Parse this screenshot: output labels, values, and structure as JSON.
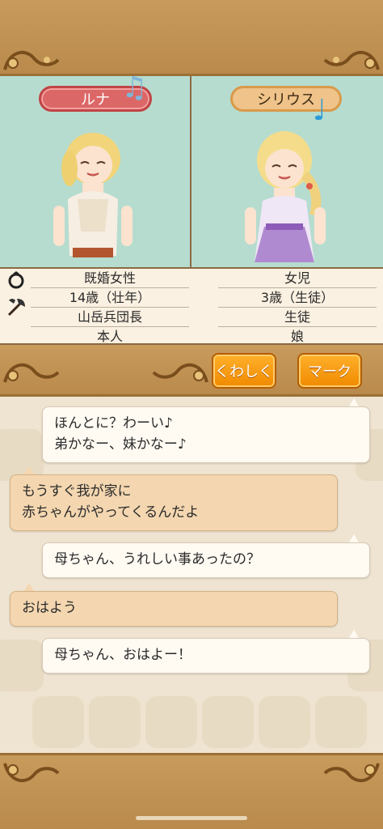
{
  "profiles": {
    "left": {
      "name": "ルナ",
      "rows": [
        "既婚女性",
        "14歳（壮年）",
        "山岳兵団長",
        "本人"
      ]
    },
    "right": {
      "name": "シリウス",
      "rows": [
        "女児",
        "3歳（生徒）",
        "生徒",
        "娘"
      ]
    }
  },
  "icons": {
    "row1": "ring-icon",
    "row3": "axe-icon"
  },
  "buttons": {
    "details": "くわしく",
    "mark": "マーク"
  },
  "chat": [
    {
      "side": "self",
      "lines": [
        "ほんとに？わーい♪",
        "弟かなー、妹かなー♪"
      ]
    },
    {
      "side": "other",
      "lines": [
        "もうすぐ我が家に",
        "赤ちゃんがやってくるんだよ"
      ]
    },
    {
      "side": "self",
      "lines": [
        "母ちゃん、うれしい事あったの？"
      ]
    },
    {
      "side": "other",
      "lines": [
        "おはよう"
      ]
    },
    {
      "side": "self",
      "lines": [
        "母ちゃん、おはよー！"
      ]
    }
  ],
  "colors": {
    "frame": "#c79a5a",
    "portrait_bg": "#b6dccf",
    "name_left": "#dc6767",
    "name_right": "#efc38a",
    "button": "#f39a10"
  }
}
